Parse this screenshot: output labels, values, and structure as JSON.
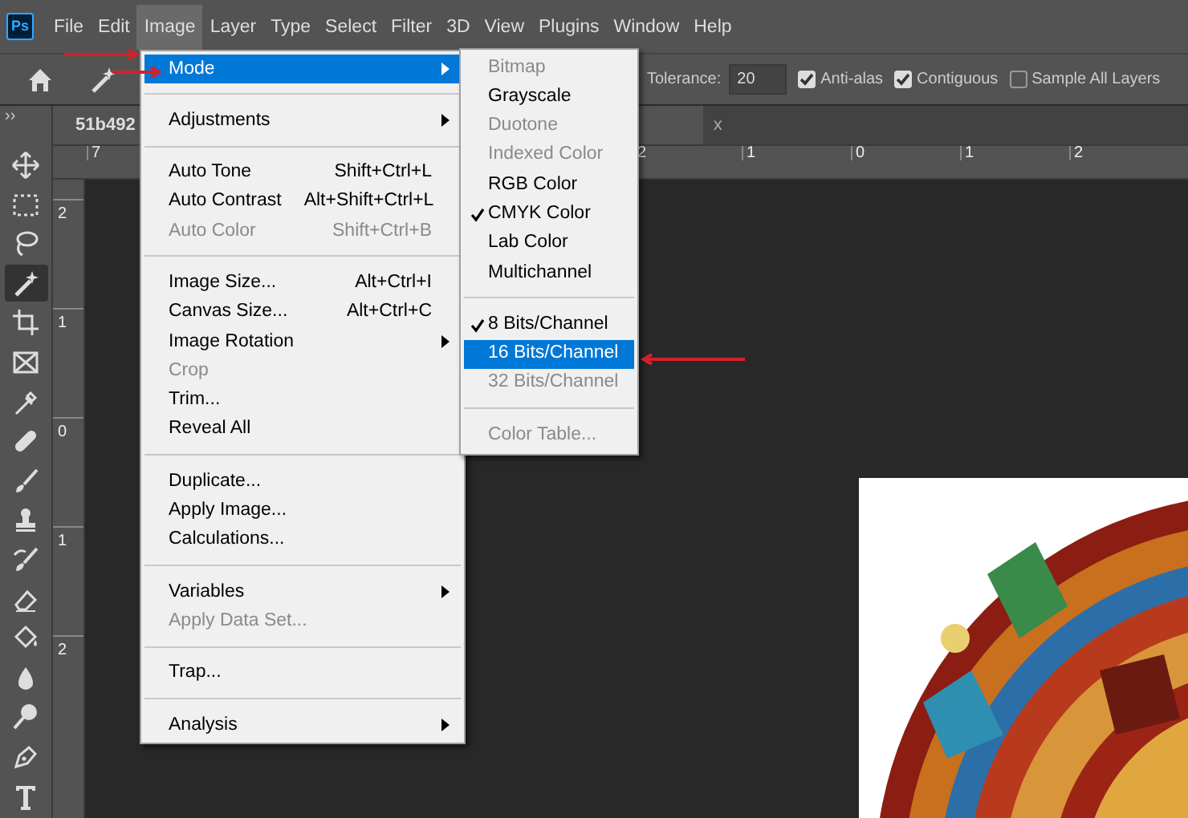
{
  "app_logo": "Ps",
  "menubar": [
    {
      "label": "File",
      "selected": false
    },
    {
      "label": "Edit",
      "selected": false
    },
    {
      "label": "Image",
      "selected": true
    },
    {
      "label": "Layer",
      "selected": false
    },
    {
      "label": "Type",
      "selected": false
    },
    {
      "label": "Select",
      "selected": false
    },
    {
      "label": "Filter",
      "selected": false
    },
    {
      "label": "3D",
      "selected": false
    },
    {
      "label": "View",
      "selected": false
    },
    {
      "label": "Plugins",
      "selected": false
    },
    {
      "label": "Window",
      "selected": false
    },
    {
      "label": "Help",
      "selected": false
    }
  ],
  "options_bar": {
    "tolerance_label": "Tolerance:",
    "tolerance_value": "20",
    "checkboxes": [
      {
        "label": "Anti-alas",
        "checked": true
      },
      {
        "label": "Contiguous",
        "checked": true
      },
      {
        "label": "Sample All Layers",
        "checked": false
      }
    ]
  },
  "toolbar": {
    "collapse": "››",
    "tools": [
      {
        "kind": "move",
        "selected": false
      },
      {
        "kind": "marquee",
        "selected": false
      },
      {
        "kind": "lasso",
        "selected": false
      },
      {
        "kind": "wand",
        "selected": true
      },
      {
        "kind": "crop",
        "selected": false
      },
      {
        "kind": "frame",
        "selected": false
      },
      {
        "kind": "eyedropper",
        "selected": false
      },
      {
        "kind": "healing",
        "selected": false
      },
      {
        "kind": "brush",
        "selected": false
      },
      {
        "kind": "stamp",
        "selected": false
      },
      {
        "kind": "history",
        "selected": false
      },
      {
        "kind": "eraser",
        "selected": false
      },
      {
        "kind": "bucket",
        "selected": false
      },
      {
        "kind": "blur",
        "selected": false
      },
      {
        "kind": "dodge",
        "selected": false
      },
      {
        "kind": "pen",
        "selected": false
      },
      {
        "kind": "type",
        "selected": false
      }
    ]
  },
  "document_tab": {
    "title": "51b492",
    "close": "x"
  },
  "rulers": {
    "horizontal": [
      "7",
      "2",
      "1",
      "0",
      "1",
      "2"
    ],
    "vertical": [
      "2",
      "1",
      "0",
      "1",
      "2"
    ]
  },
  "image_menu": [
    {
      "kind": "item",
      "label": "Mode",
      "submenu": true,
      "selected": true,
      "disabled": false
    },
    {
      "kind": "separator"
    },
    {
      "kind": "item",
      "label": "Adjustments",
      "submenu": true,
      "selected": false,
      "disabled": false
    },
    {
      "kind": "separator"
    },
    {
      "kind": "item",
      "label": "Auto Tone",
      "shortcut": "Shift+Ctrl+L",
      "selected": false,
      "disabled": false
    },
    {
      "kind": "item",
      "label": "Auto Contrast",
      "shortcut": "Alt+Shift+Ctrl+L",
      "selected": false,
      "disabled": false
    },
    {
      "kind": "item",
      "label": "Auto Color",
      "shortcut": "Shift+Ctrl+B",
      "selected": false,
      "disabled": true
    },
    {
      "kind": "separator"
    },
    {
      "kind": "item",
      "label": "Image Size...",
      "shortcut": "Alt+Ctrl+I",
      "selected": false,
      "disabled": false
    },
    {
      "kind": "item",
      "label": "Canvas Size...",
      "shortcut": "Alt+Ctrl+C",
      "selected": false,
      "disabled": false
    },
    {
      "kind": "item",
      "label": "Image Rotation",
      "submenu": true,
      "selected": false,
      "disabled": false
    },
    {
      "kind": "item",
      "label": "Crop",
      "selected": false,
      "disabled": true
    },
    {
      "kind": "item",
      "label": "Trim...",
      "selected": false,
      "disabled": false
    },
    {
      "kind": "item",
      "label": "Reveal All",
      "selected": false,
      "disabled": false
    },
    {
      "kind": "separator"
    },
    {
      "kind": "item",
      "label": "Duplicate...",
      "selected": false,
      "disabled": false
    },
    {
      "kind": "item",
      "label": "Apply Image...",
      "selected": false,
      "disabled": false
    },
    {
      "kind": "item",
      "label": "Calculations...",
      "selected": false,
      "disabled": false
    },
    {
      "kind": "separator"
    },
    {
      "kind": "item",
      "label": "Variables",
      "submenu": true,
      "selected": false,
      "disabled": false
    },
    {
      "kind": "item",
      "label": "Apply Data Set...",
      "selected": false,
      "disabled": true
    },
    {
      "kind": "separator"
    },
    {
      "kind": "item",
      "label": "Trap...",
      "selected": false,
      "disabled": false
    },
    {
      "kind": "separator"
    },
    {
      "kind": "item",
      "label": "Analysis",
      "submenu": true,
      "selected": false,
      "disabled": false
    }
  ],
  "mode_submenu": [
    {
      "kind": "item",
      "label": "Bitmap",
      "checked": false,
      "selected": false,
      "disabled": true
    },
    {
      "kind": "item",
      "label": "Grayscale",
      "checked": false,
      "selected": false,
      "disabled": false
    },
    {
      "kind": "item",
      "label": "Duotone",
      "checked": false,
      "selected": false,
      "disabled": true
    },
    {
      "kind": "item",
      "label": "Indexed Color",
      "checked": false,
      "selected": false,
      "disabled": true
    },
    {
      "kind": "item",
      "label": "RGB Color",
      "checked": false,
      "selected": false,
      "disabled": false
    },
    {
      "kind": "item",
      "label": "CMYK Color",
      "checked": true,
      "selected": false,
      "disabled": false
    },
    {
      "kind": "item",
      "label": "Lab Color",
      "checked": false,
      "selected": false,
      "disabled": false
    },
    {
      "kind": "item",
      "label": "Multichannel",
      "checked": false,
      "selected": false,
      "disabled": false
    },
    {
      "kind": "separator"
    },
    {
      "kind": "item",
      "label": "8 Bits/Channel",
      "checked": true,
      "selected": false,
      "disabled": false
    },
    {
      "kind": "item",
      "label": "16 Bits/Channel",
      "checked": false,
      "selected": true,
      "disabled": false
    },
    {
      "kind": "item",
      "label": "32 Bits/Channel",
      "checked": false,
      "selected": false,
      "disabled": true
    },
    {
      "kind": "separator"
    },
    {
      "kind": "item",
      "label": "Color Table...",
      "checked": false,
      "selected": false,
      "disabled": true
    }
  ]
}
